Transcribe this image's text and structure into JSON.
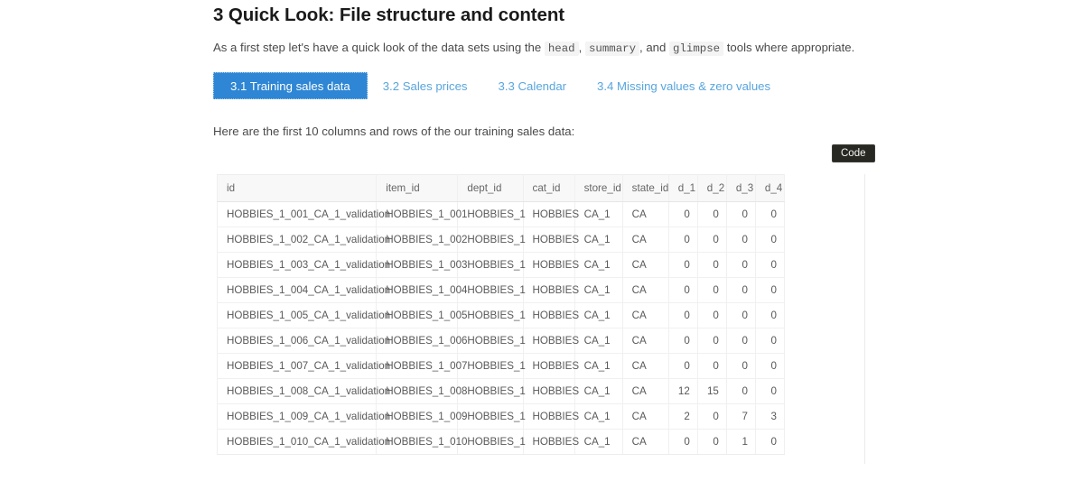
{
  "heading": "3 Quick Look: File structure and content",
  "intro": {
    "part1": "As a first step let's have a quick look of the data sets using the",
    "code1": "head",
    "sep1": ",",
    "code2": "summary",
    "sep2": ", and",
    "code3": "glimpse",
    "part2": "tools where appropriate."
  },
  "tabs": [
    {
      "label": "3.1 Training sales data",
      "active": true
    },
    {
      "label": "3.2 Sales prices",
      "active": false
    },
    {
      "label": "3.3 Calendar",
      "active": false
    },
    {
      "label": "3.4 Missing values & zero values",
      "active": false
    }
  ],
  "lead": "Here are the first 10 columns and rows of the our training sales data:",
  "code_button": "Code",
  "table": {
    "columns": [
      "id",
      "item_id",
      "dept_id",
      "cat_id",
      "store_id",
      "state_id",
      "d_1",
      "d_2",
      "d_3",
      "d_4"
    ],
    "rows": [
      [
        "HOBBIES_1_001_CA_1_validation",
        "HOBBIES_1_001",
        "HOBBIES_1",
        "HOBBIES",
        "CA_1",
        "CA",
        "0",
        "0",
        "0",
        "0"
      ],
      [
        "HOBBIES_1_002_CA_1_validation",
        "HOBBIES_1_002",
        "HOBBIES_1",
        "HOBBIES",
        "CA_1",
        "CA",
        "0",
        "0",
        "0",
        "0"
      ],
      [
        "HOBBIES_1_003_CA_1_validation",
        "HOBBIES_1_003",
        "HOBBIES_1",
        "HOBBIES",
        "CA_1",
        "CA",
        "0",
        "0",
        "0",
        "0"
      ],
      [
        "HOBBIES_1_004_CA_1_validation",
        "HOBBIES_1_004",
        "HOBBIES_1",
        "HOBBIES",
        "CA_1",
        "CA",
        "0",
        "0",
        "0",
        "0"
      ],
      [
        "HOBBIES_1_005_CA_1_validation",
        "HOBBIES_1_005",
        "HOBBIES_1",
        "HOBBIES",
        "CA_1",
        "CA",
        "0",
        "0",
        "0",
        "0"
      ],
      [
        "HOBBIES_1_006_CA_1_validation",
        "HOBBIES_1_006",
        "HOBBIES_1",
        "HOBBIES",
        "CA_1",
        "CA",
        "0",
        "0",
        "0",
        "0"
      ],
      [
        "HOBBIES_1_007_CA_1_validation",
        "HOBBIES_1_007",
        "HOBBIES_1",
        "HOBBIES",
        "CA_1",
        "CA",
        "0",
        "0",
        "0",
        "0"
      ],
      [
        "HOBBIES_1_008_CA_1_validation",
        "HOBBIES_1_008",
        "HOBBIES_1",
        "HOBBIES",
        "CA_1",
        "CA",
        "12",
        "15",
        "0",
        "0"
      ],
      [
        "HOBBIES_1_009_CA_1_validation",
        "HOBBIES_1_009",
        "HOBBIES_1",
        "HOBBIES",
        "CA_1",
        "CA",
        "2",
        "0",
        "7",
        "3"
      ],
      [
        "HOBBIES_1_010_CA_1_validation",
        "HOBBIES_1_010",
        "HOBBIES_1",
        "HOBBIES",
        "CA_1",
        "CA",
        "0",
        "0",
        "1",
        "0"
      ]
    ],
    "numeric_columns": [
      6,
      7,
      8,
      9
    ]
  },
  "colors": {
    "tab_active_bg": "#2e86d4",
    "tab_inactive_text": "#58a5dd",
    "code_button_bg": "#272822",
    "header_bg": "#f8f8f8"
  }
}
